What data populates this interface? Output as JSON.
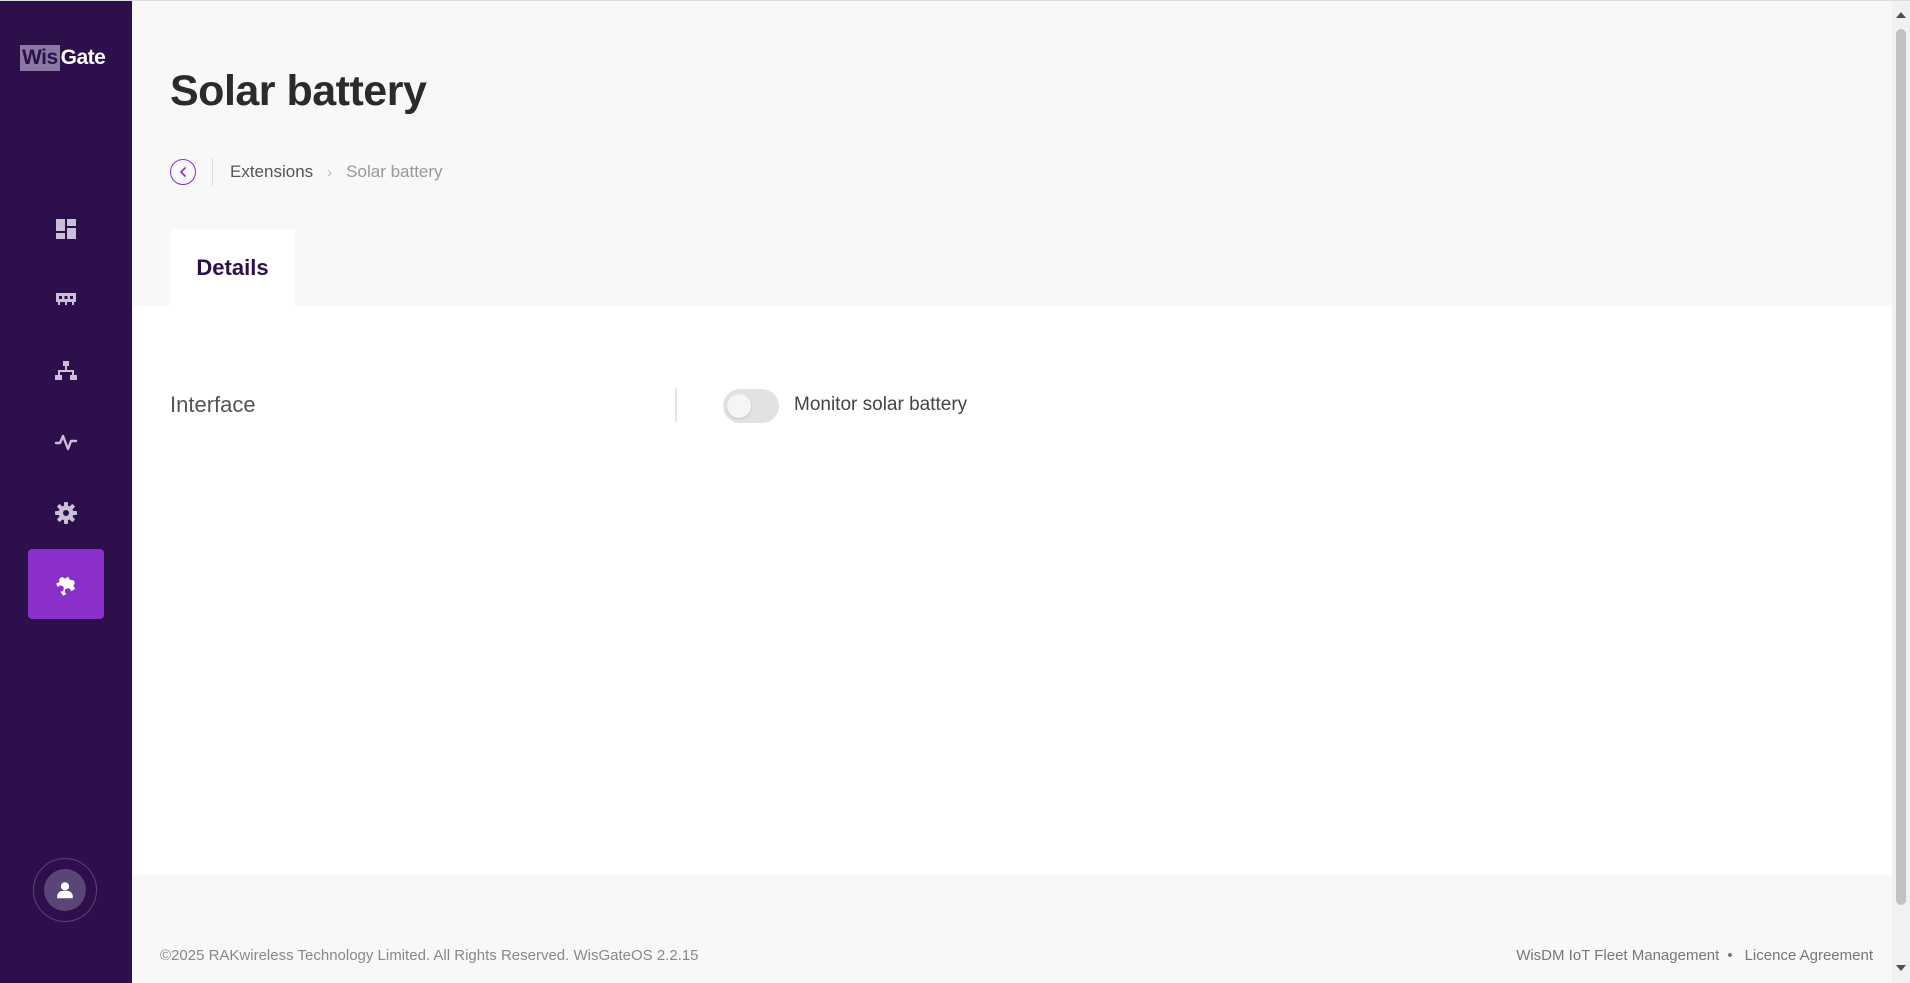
{
  "brand": {
    "logo_part1": "Wis",
    "logo_part2": "Gate"
  },
  "sidebar": {
    "items": [
      {
        "icon": "dashboard-icon",
        "active": false
      },
      {
        "icon": "gateway-icon",
        "active": false
      },
      {
        "icon": "network-icon",
        "active": false
      },
      {
        "icon": "activity-icon",
        "active": false
      },
      {
        "icon": "gear-icon",
        "active": false
      },
      {
        "icon": "puzzle-icon",
        "active": true
      }
    ],
    "user_icon": "user-icon"
  },
  "page": {
    "title": "Solar battery"
  },
  "breadcrumb": {
    "parent": "Extensions",
    "separator": "›",
    "current": "Solar battery"
  },
  "tabs": [
    {
      "label": "Details",
      "active": true
    }
  ],
  "form": {
    "interface_label": "Interface",
    "monitor_toggle": {
      "label": "Monitor solar battery",
      "checked": false
    }
  },
  "footer": {
    "copyright": "©2025 RAKwireless Technology Limited. All Rights Reserved. WisGateOS 2.2.15",
    "links": [
      "WisDM IoT Fleet Management",
      "Licence Agreement"
    ],
    "separator": "•"
  },
  "colors": {
    "sidebar_bg": "#2d0f4c",
    "accent": "#8a2fc9",
    "header_bg": "#f8f8f8"
  }
}
